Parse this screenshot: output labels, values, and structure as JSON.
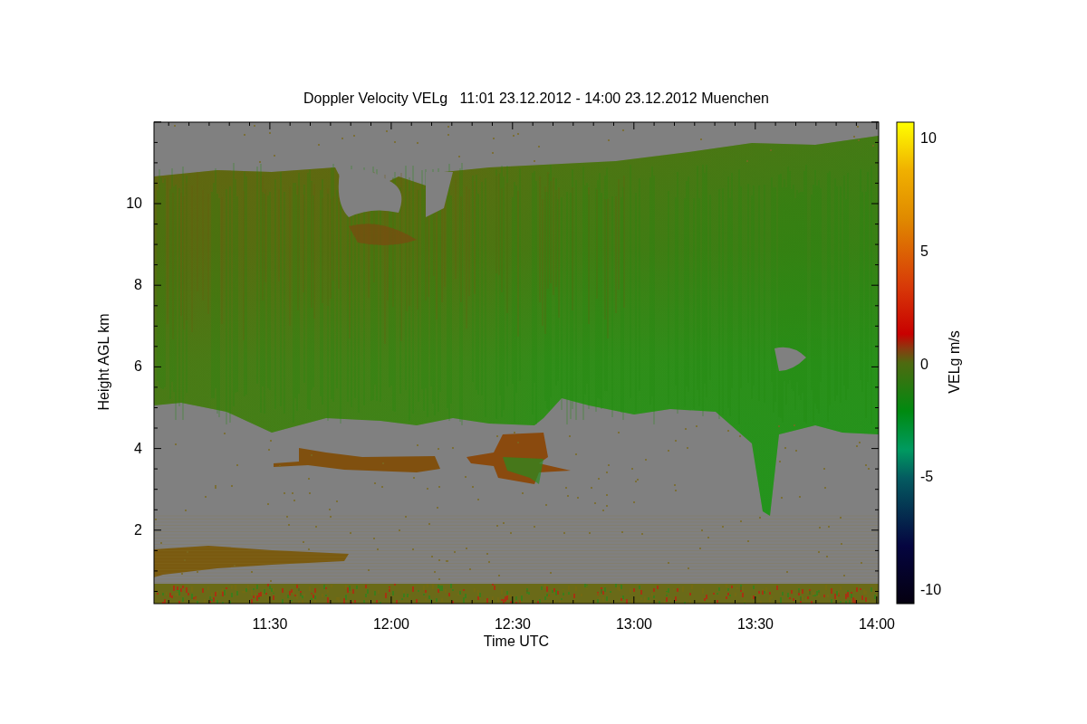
{
  "title": "Doppler Velocity VELg   11:01 23.12.2012 - 14:00 23.12.2012 Muenchen",
  "y_axis": {
    "label": "Height AGL km",
    "ticks": [
      "10",
      "8",
      "6",
      "4",
      "2"
    ]
  },
  "x_axis": {
    "label": "Time UTC",
    "ticks": [
      "11:30",
      "12:00",
      "12:30",
      "13:00",
      "13:30",
      "14:00"
    ]
  },
  "colorbar": {
    "label": "VELg m/s",
    "ticks": [
      "10",
      "5",
      "0",
      "-5",
      "-10"
    ]
  }
}
